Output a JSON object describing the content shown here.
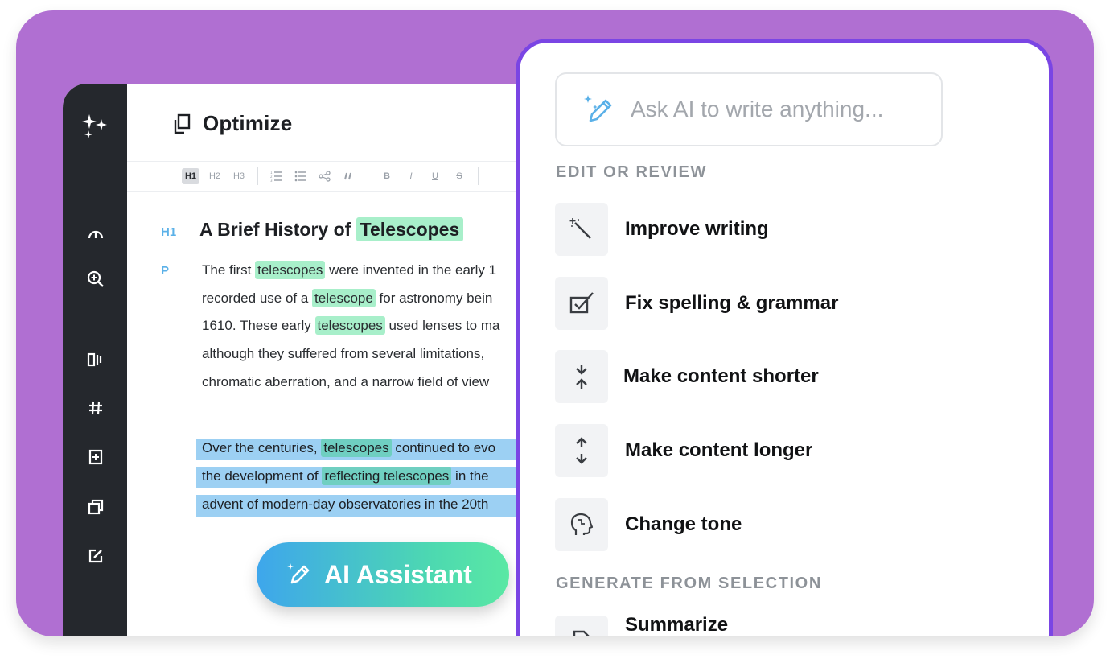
{
  "editor": {
    "title": "Optimize",
    "toolbar": {
      "h1": "H1",
      "h2": "H2",
      "h3": "H3",
      "bold": "B",
      "italic": "I",
      "underline": "U",
      "strike": "S"
    },
    "tags": {
      "h1": "H1",
      "p": "P"
    },
    "heading": {
      "prefix": "A Brief History of ",
      "highlight": "Telescopes"
    },
    "paragraph1": [
      {
        "a": "The first ",
        "h": "telescopes",
        "b": " were invented in the early 1"
      },
      {
        "a": "recorded use of a ",
        "h": "telescope",
        "b": " for astronomy bein"
      },
      {
        "a": "1610. These early ",
        "h": "telescopes",
        "b": " used lenses to ma"
      },
      {
        "a": "although they suffered from several limitations,",
        "h": "",
        "b": ""
      },
      {
        "a": "chromatic aberration, and a narrow field of view",
        "h": "",
        "b": ""
      }
    ],
    "paragraph2": [
      {
        "a": "Over the centuries, ",
        "h": "telescopes",
        "b": " continued to evo"
      },
      {
        "a": "the development of ",
        "h": "reflecting telescopes",
        "b": " in the"
      },
      {
        "a": "advent of modern-day observatories in the 20th",
        "h": "",
        "b": ""
      }
    ],
    "ai_button": "AI Assistant"
  },
  "panel": {
    "ask_placeholder": "Ask AI to write anything...",
    "section_edit": "EDIT OR REVIEW",
    "items": [
      {
        "label": "Improve writing",
        "icon": "magic-wand-icon"
      },
      {
        "label": "Fix spelling & grammar",
        "icon": "checkbox-icon"
      },
      {
        "label": "Make content shorter",
        "icon": "arrows-inward-icon"
      },
      {
        "label": "Make content longer",
        "icon": "arrows-outward-icon"
      },
      {
        "label": "Change tone",
        "icon": "head-icon"
      }
    ],
    "section_generate": "GENERATE FROM SELECTION",
    "generate_items": [
      {
        "label": "Summarize",
        "icon": "document-icon"
      }
    ]
  },
  "colors": {
    "background": "#b06fd2",
    "rail": "#25282d",
    "panel_border": "#7a45e4",
    "highlight_green": "#a8efca",
    "selection_blue": "#9cd0f3"
  }
}
